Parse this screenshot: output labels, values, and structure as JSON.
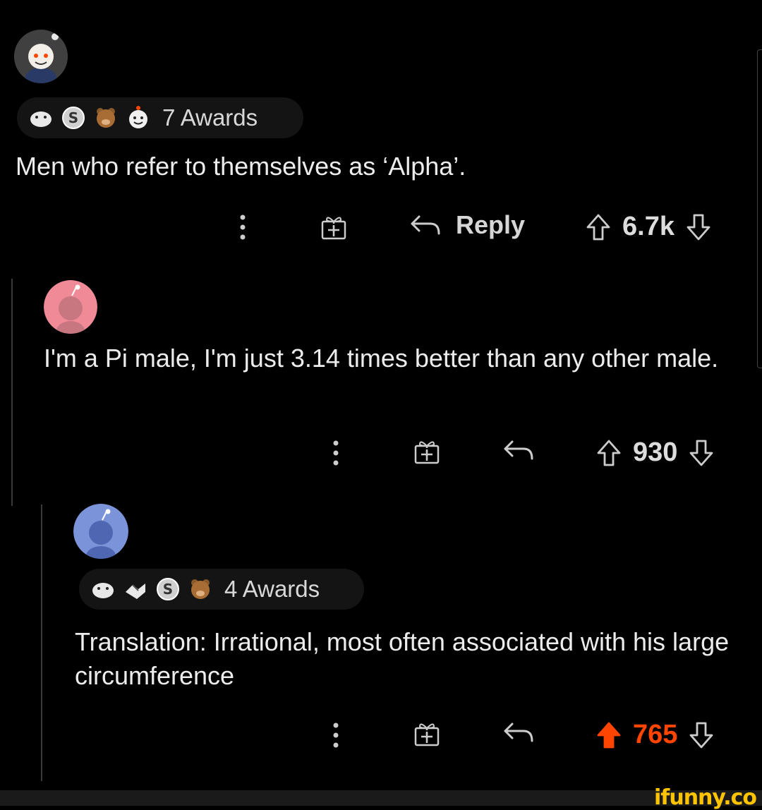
{
  "comments": [
    {
      "awards_label": "7 Awards",
      "text": "Men who refer to themselves as ‘Alpha’.",
      "reply_label": "Reply",
      "score": "6.7k"
    },
    {
      "text": "I'm a Pi male, I'm just 3.14 times better than any other male.",
      "score": "930"
    },
    {
      "awards_label": "4 Awards",
      "text": "Translation: Irrational, most often associated with his large circumference",
      "score": "765",
      "upvoted": true
    }
  ],
  "watermark": "ifunny.co",
  "colors": {
    "background": "#000000",
    "upvote_active": "#ff4500",
    "brand": "#ffc400"
  }
}
